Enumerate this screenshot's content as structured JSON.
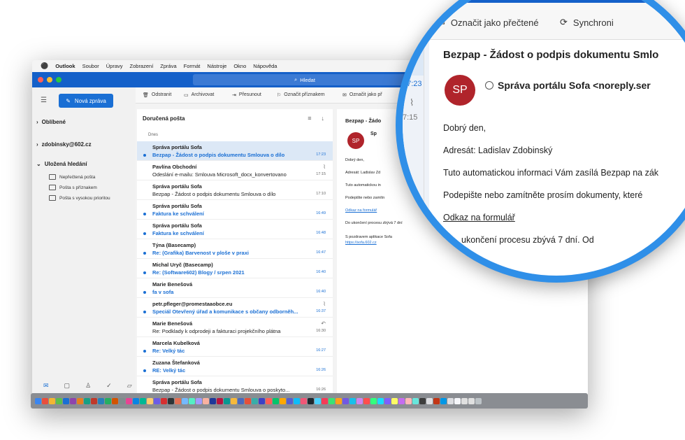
{
  "menubar": {
    "app": "Outlook",
    "items": [
      "Soubor",
      "Úpravy",
      "Zobrazení",
      "Zpráva",
      "Formát",
      "Nástroje",
      "Okno",
      "Nápověda"
    ]
  },
  "search": {
    "label": "Hledat"
  },
  "nav": {
    "new_mail": "Nová zpráva",
    "favorites": "Oblíbené",
    "account": "zdobinsky@602.cz",
    "saved_searches": "Uložená hledání",
    "saved_items": [
      "Nepřečtená pošta",
      "Pošta s příznakem",
      "Pošta s vysokou prioritou"
    ]
  },
  "toolbar": {
    "delete": "Odstranit",
    "archive": "Archivovat",
    "move": "Přesunout",
    "flag": "Označit příznakem",
    "mark_read": "Označit jako př",
    "mark_read_full": "Označit jako přečtené",
    "sync": "Synchroni"
  },
  "list": {
    "title": "Doručená pošta",
    "group": "Dnes",
    "messages": [
      {
        "from": "Správa portálu Sofa",
        "subject": "Bezpap - Žádost o podpis dokumentu Smlouva o dílo",
        "time": "17:23"
      },
      {
        "from": "Pavlína Obchodní",
        "subject": "Odeslání e-mailu: Smlouva Microsoft_docx_konvertovano",
        "time": "17:15"
      },
      {
        "from": "Správa portálu Sofa",
        "subject": "Bezpap - Žádost o podpis dokumentu Smlouva o dílo",
        "time": "17:10"
      },
      {
        "from": "Správa portálu Sofa",
        "subject": "Faktura ke schválení",
        "time": "16:49"
      },
      {
        "from": "Správa portálu Sofa",
        "subject": "Faktura ke schválení",
        "time": "16:48"
      },
      {
        "from": "Týna (Basecamp)",
        "subject": "Re: (Grafika) Barvenost v ploše v praxi",
        "time": "16:47"
      },
      {
        "from": "Michal Uryč (Basecamp)",
        "subject": "Re: (Software602) Blogy / srpen 2021",
        "time": "16:40"
      },
      {
        "from": "Marie Benešová",
        "subject": "fa v sofa",
        "time": "16:40"
      },
      {
        "from": "petr.pfleger@promestaaobce.eu",
        "subject": "Speciál Otevřený úřad a komunikace s občany odborněh...",
        "time": "16:37"
      },
      {
        "from": "Marie Benešová",
        "subject": "Re: Podklady k odprodeji a fakturaci projekčního plátna",
        "time": "16:30"
      },
      {
        "from": "Marcela Kubelková",
        "subject": "Re: Velký tác",
        "time": "16:27"
      },
      {
        "from": "Zuzana Štefanková",
        "subject": "RE: Velký tác",
        "time": "16:26"
      },
      {
        "from": "Správa portálu Sofa",
        "subject": "Bezpap - Žádost o podpis dokumentu Smlouva o poskyto...",
        "time": "16:26"
      }
    ]
  },
  "reading": {
    "title_short": "Bezpap - Žádo",
    "title": "Bezpap - Žádost o podpis dokumentu Smlo",
    "avatar": "SP",
    "from_short": "Sp",
    "from": "Správa portálu Sofa <noreply.ser",
    "time": "17:23",
    "time2": "7:15",
    "greeting": "Dobrý den,",
    "addressee_short": "Adresát: Ladislav Zd",
    "addressee": "Adresát: Ladislav Zdobinský",
    "info_short": "Tuto automatickou in",
    "info": "Tuto automatickou informaci Vám zasílá Bezpap na zák",
    "sign_short": "Podepište nebo zamítn",
    "sign": "Podepište nebo zamítněte prosím dokumenty, které",
    "link": "Odkaz na formulář",
    "deadline_short": "Do ukončení procesu zbývá 7 dní",
    "deadline": "ukončení procesu zbývá 7 dní. Od",
    "regards": "S pozdravem aplikace Sofa",
    "site": "https://sofa.602.cz"
  }
}
